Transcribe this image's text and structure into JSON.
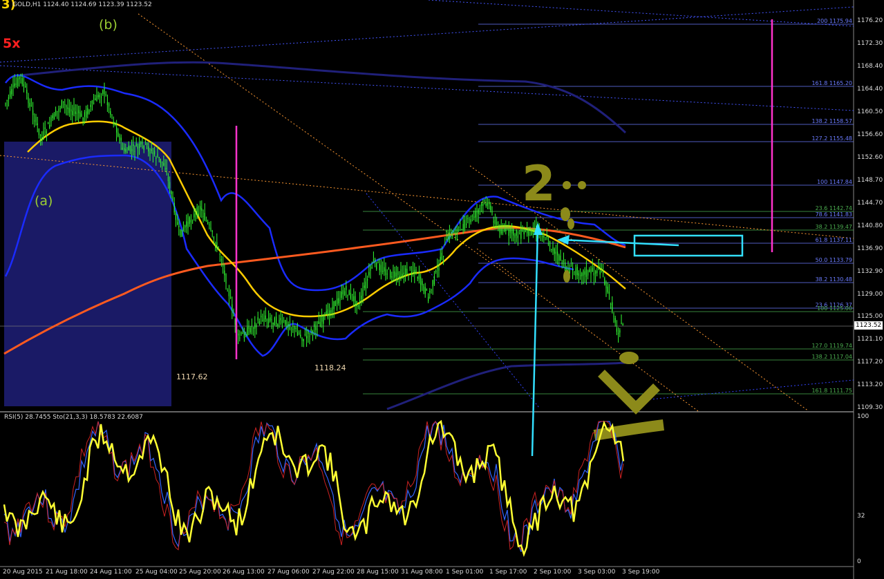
{
  "header": {
    "symbol_info": "GOLD,H1  1124.40 1124.69 1123.39 1123.52",
    "corner_label": "3)"
  },
  "annotations": {
    "wave_b": "(b)",
    "wave_a": "(a)",
    "multiplier": "5x",
    "low1": "1117.62",
    "low2": "1118.24",
    "wave_2": "2",
    "wave_3": "3"
  },
  "price_axis": {
    "ticks": [
      "1176.20",
      "1172.30",
      "1168.40",
      "1164.40",
      "1160.50",
      "1156.60",
      "1152.60",
      "1148.70",
      "1144.70",
      "1140.80",
      "1136.90",
      "1132.90",
      "1129.00",
      "1125.00",
      "1121.10",
      "1117.20",
      "1113.20",
      "1109.30"
    ],
    "current_price": "1123.52"
  },
  "fib_levels": [
    {
      "label": "200 1175.94",
      "color": "#6b7cff"
    },
    {
      "label": "161.8 1165.20",
      "color": "#6b7cff"
    },
    {
      "label": "138.2 1158.57",
      "color": "#6b7cff"
    },
    {
      "label": "127.2 1155.48",
      "color": "#6b7cff"
    },
    {
      "label": "100 1147.84",
      "color": "#6b7cff"
    },
    {
      "label": "23.6 1142.74",
      "color": "#4caf50"
    },
    {
      "label": "78.6 1141.83",
      "color": "#6b7cff"
    },
    {
      "label": "38.2 1139.47",
      "color": "#4caf50"
    },
    {
      "label": "61.8 1137.11",
      "color": "#6b7cff"
    },
    {
      "label": "50.0 1133.79",
      "color": "#6b7cff"
    },
    {
      "label": "38.2 1130.48",
      "color": "#6b7cff"
    },
    {
      "label": "23.6 1126.37",
      "color": "#6b7cff"
    },
    {
      "label": "100 1125.00",
      "color": "#4caf50"
    },
    {
      "label": "127.0 1119.74",
      "color": "#4caf50"
    },
    {
      "label": "138.2 1117.04",
      "color": "#4caf50"
    },
    {
      "label": "161.8 1111.75",
      "color": "#4caf50"
    }
  ],
  "indicator": {
    "label": "RSI(5) 28.7455  Sto(21,3,3) 18.5783 22.6087",
    "axis_ticks": [
      "100",
      "32",
      "0"
    ]
  },
  "time_axis": [
    "20 Aug 2015",
    "21 Aug 18:00",
    "24 Aug 11:00",
    "25 Aug 04:00",
    "25 Aug 20:00",
    "26 Aug 13:00",
    "27 Aug 06:00",
    "27 Aug 22:00",
    "28 Aug 15:00",
    "31 Aug 08:00",
    "1 Sep 01:00",
    "1 Sep 17:00",
    "2 Sep 10:00",
    "3 Sep 03:00",
    "3 Sep 19:00"
  ],
  "colors": {
    "background": "#000000",
    "bull_candle": "#33ff33",
    "ma_fast": "#ffcc00",
    "ma_slow": "#ff5a1f",
    "bollinger": "#1a2bff",
    "magenta": "#ff33cc",
    "cyan": "#33e0ff",
    "wave_text": "#8c8a1a"
  }
}
